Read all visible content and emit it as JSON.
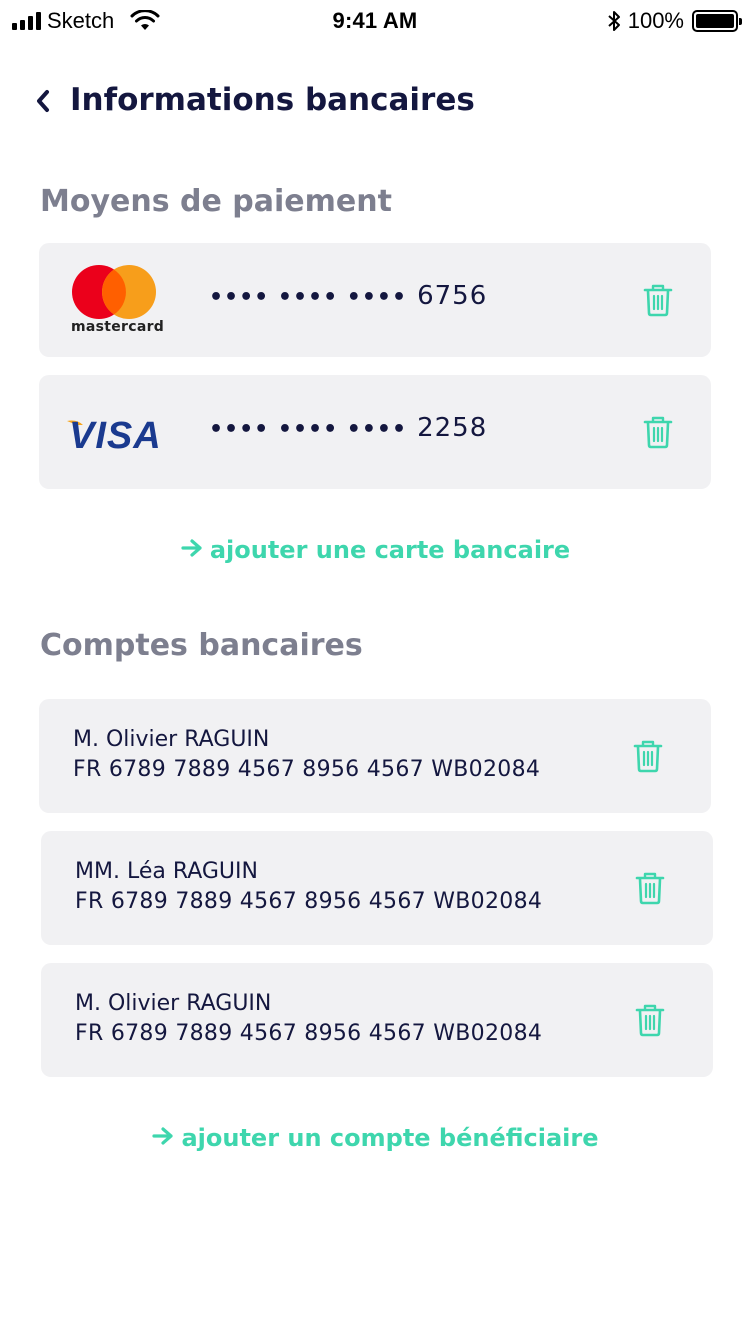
{
  "status_bar": {
    "carrier": "Sketch",
    "time": "9:41 AM",
    "battery": "100%"
  },
  "header": {
    "title": "Informations bancaires"
  },
  "payment_section": {
    "title": "Moyens de paiement",
    "cards": [
      {
        "brand": "mastercard",
        "brand_text": "mastercard",
        "dots": "•••• •••• ••••",
        "last4": "6756"
      },
      {
        "brand": "visa",
        "brand_text": "VISA",
        "dots": "•••• •••• ••••",
        "last4": "2258"
      }
    ],
    "add_label": "ajouter une carte bancaire"
  },
  "accounts_section": {
    "title": "Comptes bancaires",
    "accounts": [
      {
        "name": "M. Olivier RAGUIN",
        "iban": "FR 6789 7889 4567 8956 4567 WB02084"
      },
      {
        "name": "MM. Léa RAGUIN",
        "iban": "FR 6789 7889 4567 8956 4567 WB02084"
      },
      {
        "name": "M. Olivier RAGUIN",
        "iban": "FR 6789 7889 4567 8956 4567 WB02084"
      }
    ],
    "add_label": "ajouter un compte bénéficiaire"
  },
  "colors": {
    "accent": "#3ed6ad",
    "title": "#14173f",
    "section": "#7d7f8f",
    "card_bg": "#f1f1f3"
  },
  "icons": {
    "back": "chevron-left-icon",
    "delete": "trash-icon",
    "add": "arrow-right-icon"
  }
}
